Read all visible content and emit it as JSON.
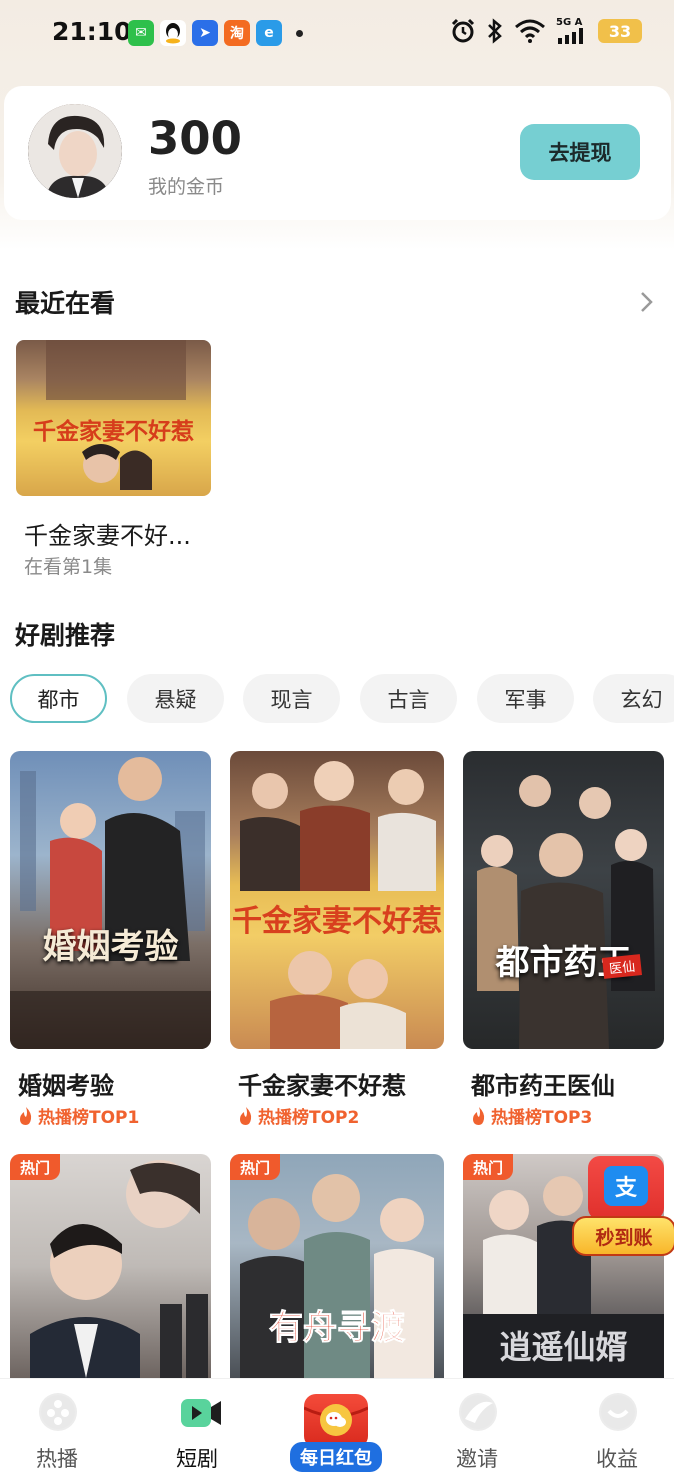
{
  "status_bar": {
    "time": "21:10",
    "apps": [
      {
        "name": "wechat-icon",
        "color": "#2ec04b",
        "glyph": "✉"
      },
      {
        "name": "qq-icon",
        "color": "#ffffff",
        "glyph": "🐧"
      },
      {
        "name": "paper-plane-app-icon",
        "color": "#2b6fe8",
        "glyph": "➤"
      },
      {
        "name": "taobao-icon",
        "color": "#f36b21",
        "glyph": "淘"
      },
      {
        "name": "browser-app-icon",
        "color": "#2a9be8",
        "glyph": "e"
      }
    ],
    "network": "5G A",
    "battery": "33"
  },
  "coins": {
    "value": "300",
    "label": "我的金币",
    "withdraw_label": "去提现"
  },
  "recent": {
    "section_title": "最近在看",
    "item": {
      "poster_text": "千金家妻不好惹",
      "title": "千金家妻不好...",
      "progress": "在看第1集"
    }
  },
  "recommend": {
    "section_title": "好剧推荐",
    "categories": [
      "都市",
      "悬疑",
      "现言",
      "古言",
      "军事",
      "玄幻"
    ],
    "selected_category": "都市",
    "dramas": [
      {
        "title": "婚姻考验",
        "rank": "热播榜TOP1",
        "poster_text": "婚姻考验"
      },
      {
        "title": "千金家妻不好惹",
        "rank": "热播榜TOP2",
        "poster_text": "千金家妻不好惹"
      },
      {
        "title": "都市药王医仙",
        "rank": "热播榜TOP3",
        "poster_text": "都市药王",
        "poster_tag": "医仙"
      }
    ],
    "hot_dramas": [
      {
        "badge": "热门",
        "poster_text": ""
      },
      {
        "badge": "热门",
        "poster_text": "有舟寻渡"
      },
      {
        "badge": "热门",
        "poster_text": "逍遥仙婿"
      }
    ],
    "promo": {
      "alipay_glyph": "支",
      "label": "秒到账"
    }
  },
  "bottom_nav": {
    "items": [
      {
        "label": "热播",
        "icon": "film-reel-icon"
      },
      {
        "label": "短剧",
        "icon": "video-camera-icon"
      },
      {
        "label": "每日红包",
        "icon": "red-packet-icon"
      },
      {
        "label": "邀请",
        "icon": "invite-icon"
      },
      {
        "label": "收益",
        "icon": "earnings-icon"
      }
    ],
    "active": "短剧"
  }
}
